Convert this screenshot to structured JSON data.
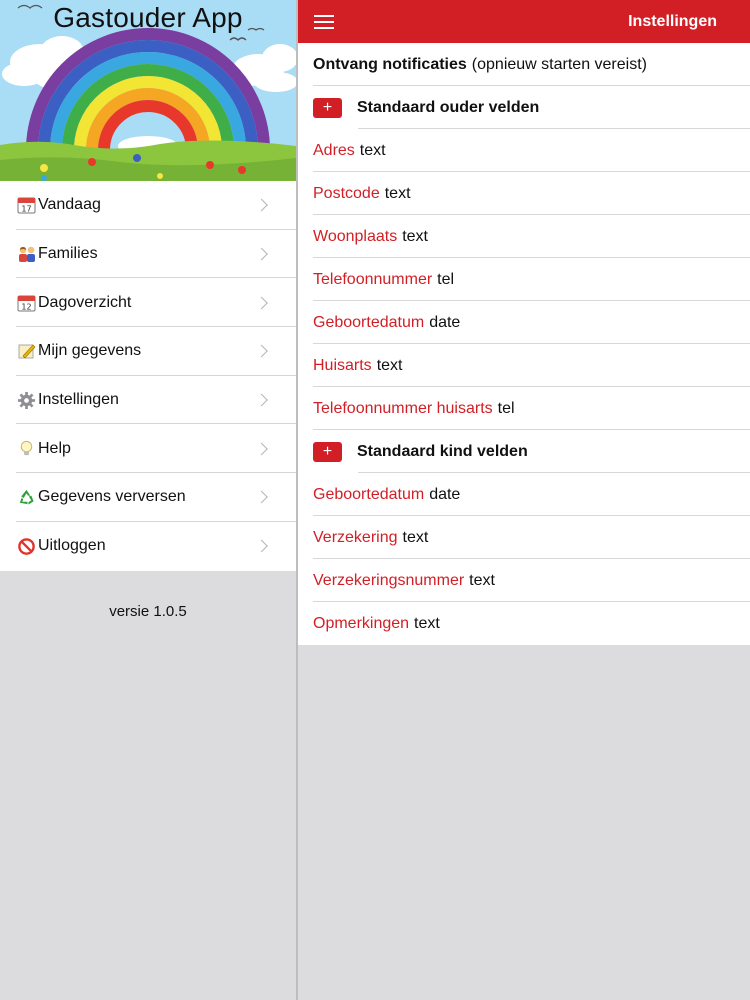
{
  "sidebar": {
    "app_title": "Gastouder App",
    "version": "versie 1.0.5",
    "items": [
      {
        "label": "Vandaag",
        "icon": "calendar-icon"
      },
      {
        "label": "Families",
        "icon": "family-icon"
      },
      {
        "label": "Dagoverzicht",
        "icon": "calendar-icon"
      },
      {
        "label": "Mijn gegevens",
        "icon": "notepad-icon"
      },
      {
        "label": "Instellingen",
        "icon": "gear-icon"
      },
      {
        "label": "Help",
        "icon": "lightbulb-icon"
      },
      {
        "label": "Gegevens verversen",
        "icon": "recycle-icon"
      },
      {
        "label": "Uitloggen",
        "icon": "no-entry-icon"
      }
    ]
  },
  "navbar": {
    "title": "Instellingen"
  },
  "settings": {
    "notifications": {
      "label": "Ontvang notificaties",
      "note": "(opnieuw starten vereist)"
    },
    "parent_section": {
      "title": "Standaard ouder velden",
      "add_label": "+",
      "fields": [
        {
          "name": "Adres",
          "type": "text"
        },
        {
          "name": "Postcode",
          "type": "text"
        },
        {
          "name": "Woonplaats",
          "type": "text"
        },
        {
          "name": "Telefoonnummer",
          "type": "tel"
        },
        {
          "name": "Geboortedatum",
          "type": "date"
        },
        {
          "name": "Huisarts",
          "type": "text"
        },
        {
          "name": "Telefoonnummer huisarts",
          "type": "tel"
        }
      ]
    },
    "child_section": {
      "title": "Standaard kind velden",
      "add_label": "+",
      "fields": [
        {
          "name": "Geboortedatum",
          "type": "date"
        },
        {
          "name": "Verzekering",
          "type": "text"
        },
        {
          "name": "Verzekeringsnummer",
          "type": "text"
        },
        {
          "name": "Opmerkingen",
          "type": "text"
        }
      ]
    }
  },
  "colors": {
    "accent": "#d21f26",
    "sky": "#a8dcf5",
    "grass": "#8cc63f"
  }
}
